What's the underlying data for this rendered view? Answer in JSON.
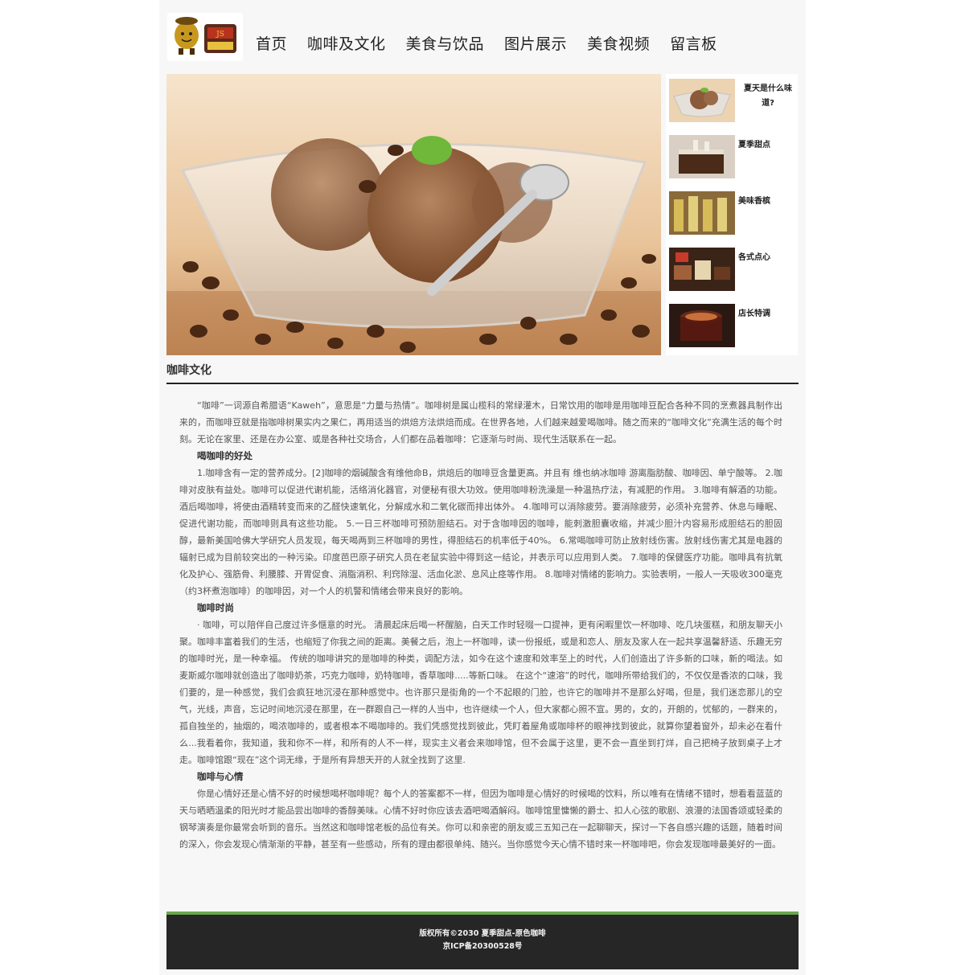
{
  "nav": {
    "items": [
      "首页",
      "咖啡及文化",
      "美食与饮品",
      "图片展示",
      "美食视频",
      "留言板"
    ]
  },
  "logo": {
    "icon": "coffee-mascot-logo",
    "text": "原色咖啡"
  },
  "sidebar": {
    "items": [
      {
        "label": "夏天是什么味道?",
        "icon": "ice-cream-thumb"
      },
      {
        "label": "夏季甜点",
        "icon": "cake-thumb"
      },
      {
        "label": "美味香槟",
        "icon": "champagne-thumb"
      },
      {
        "label": "各式点心",
        "icon": "pastry-thumb"
      },
      {
        "label": "店长特调",
        "icon": "drink-thumb"
      }
    ]
  },
  "section": {
    "title": "咖啡文化"
  },
  "article": {
    "p1": "“咖啡”一词源自希腊语“Kaweh”，意思是“力量与热情”。咖啡树是属山榄科的常绿灌木，日常饮用的咖啡是用咖啡豆配合各种不同的烹煮器具制作出来的，而咖啡豆就是指咖啡树果实内之果仁，再用适当的烘焙方法烘焙而成。在世界各地，人们越来越爱喝咖啡。随之而来的“咖啡文化”充满生活的每个时刻。无论在家里、还是在办公室、或是各种社交场合，人们都在品着咖啡：它逐渐与时尚、现代生活联系在一起。",
    "h1": "喝咖啡的好处",
    "p2": "1.咖啡含有一定的营养成分。[2]咖啡的烟碱酸含有维他命B，烘焙后的咖啡豆含量更高。并且有 维也纳冰咖啡 游离脂肪酸、咖啡因、单宁酸等。 2.咖啡对皮肤有益处。咖啡可以促进代谢机能，活络消化器官，对便秘有很大功效。使用咖啡粉洗澡是一种温热疗法，有减肥的作用。 3.咖啡有解酒的功能。酒后喝咖啡，将使由酒精转变而来的乙醛快速氧化，分解成水和二氧化碳而排出体外。 4.咖啡可以消除疲劳。要消除疲劳，必须补充营养、休息与睡眠、促进代谢功能，而咖啡则具有这些功能。 5.一日三杯咖啡可预防胆结石。对于含咖啡因的咖啡，能刺激胆囊收缩，并减少胆汁内容易形成胆结石的胆固醇，最新美国哈佛大学研究人员发现，每天喝两到三杯咖啡的男性，得胆结石的机率低于40%。 6.常喝咖啡可防止放射线伤害。放射线伤害尤其是电器的辐射已成为目前较突出的一种污染。印度芭巴原子研究人员在老鼠实验中得到这一结论，并表示可以应用到人类。 7.咖啡的保健医疗功能。咖啡具有抗氧化及护心、强筋骨、利腰膝、开胃促食、消脂消积、利窍除湿、活血化淤、息风止痉等作用。 8.咖啡对情绪的影响力。实验表明，一般人一天吸收300毫克（约3杯煮泡咖啡）的咖啡因，对一个人的机警和情绪会带来良好的影响。",
    "h2": "咖啡时尚",
    "p3": "· 咖啡，可以陪伴自己度过许多惬意的时光。 清晨起床后喝一杯醒脑，白天工作时轻啜一口提神，更有闲暇里饮一杯咖啡、吃几块蛋糕，和朋友聊天小聚。咖啡丰富着我们的生活，也缩短了你我之间的距离。美餐之后，泡上一杯咖啡，读一份报纸，或是和恋人、朋友及家人在一起共享温馨舒适、乐趣无穷的咖啡时光，是一种幸福。 传统的咖啡讲究的是咖啡的种类，调配方法，如今在这个速度和效率至上的时代，人们创造出了许多新的口味，新的喝法。如麦斯威尔咖啡就创造出了咖啡奶茶，巧克力咖啡，奶特咖啡，香草咖啡.....等新口味。 在这个“速溶”的时代，咖啡所带给我们的，不仅仅是香浓的口味，我们要的，是一种感觉，我们会疯狂地沉浸在那种感觉中。也许那只是街角的一个不起眼的门脸，也许它的咖啡并不是那么好喝，但是，我们迷恋那儿的空气，光线，声音，忘记时间地沉浸在那里，在一群跟自己一样的人当中，也许继续一个人，但大家都心照不宣。男的，女的，开朗的，忧郁的，一群来的，孤自独坐的，抽烟的，喝浓咖啡的，或者根本不喝咖啡的。我们凭感觉找到彼此，凭盯着屋角或咖啡杯的眼神找到彼此，就算你望着窗外，却未必在看什么...我看着你，我知道，我和你不一样，和所有的人不一样，现实主义者会来咖啡馆，但不会属于这里，更不会一直坐到打烊，自己把椅子放到桌子上才走。咖啡馆跟“现在”这个词无缘，于是所有异想天开的人就全找到了这里.",
    "h3": "咖啡与心情",
    "p4": "你是心情好还是心情不好的时候想喝杯咖啡呢？每个人的答案都不一样，但因为咖啡是心情好的时候喝的饮料，所以唯有在情绪不错时，想看看蓝蓝的天与晒晒温柔的阳光时才能品尝出咖啡的香醇美味。心情不好时你应该去酒吧喝酒解闷。咖啡馆里慵懒的爵士、扣人心弦的歌剧、浪漫的法国香颂或轻柔的钢琴演奏是你最常会听到的音乐。当然这和咖啡馆老板的品位有关。你可以和亲密的朋友或三五知己在一起聊聊天，探讨一下各自感兴趣的话题，随着时间的深入，你会发现心情渐渐的平静，甚至有一些感动，所有的理由都很单纯、随兴。当你感觉今天心情不错时来一杯咖啡吧，你会发现咖啡最美好的一面。"
  },
  "footer": {
    "copyright": "版权所有©2030 夏季甜点-原色咖啡",
    "icp": "京ICP备20300528号"
  },
  "colors": {
    "footer_bg": "#262626",
    "footer_accent": "#6aa84f",
    "page_bg": "#f7f7f7"
  }
}
